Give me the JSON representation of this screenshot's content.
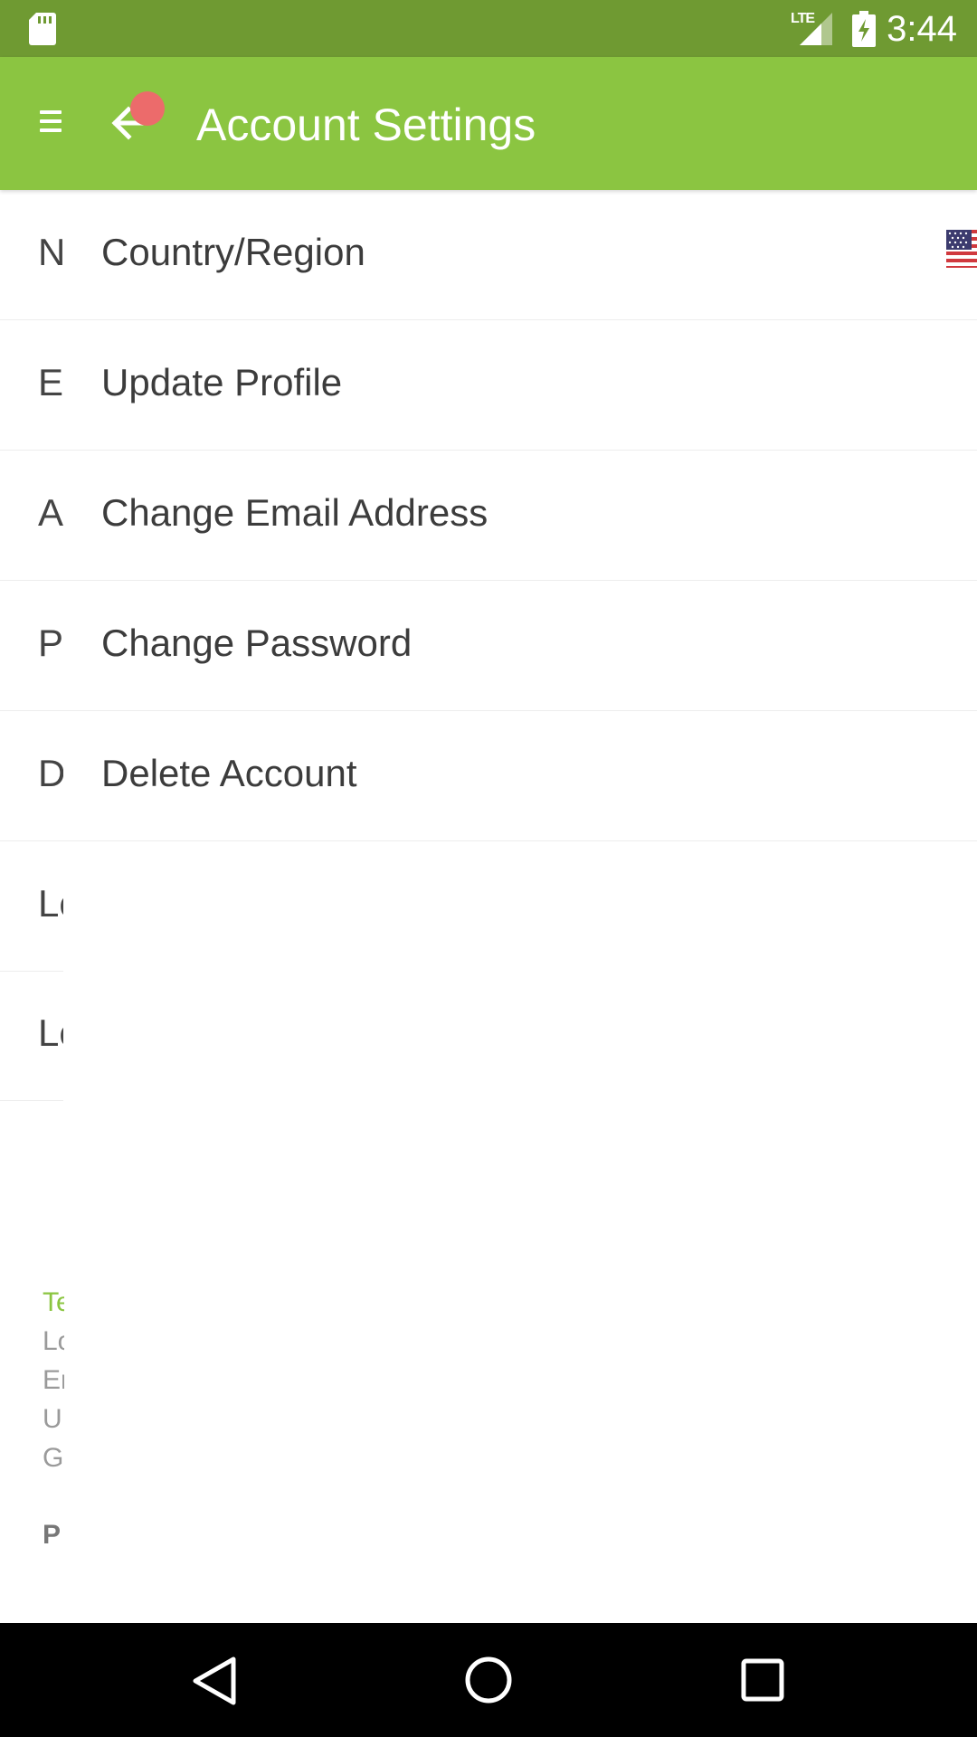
{
  "status_bar": {
    "network": "LTE",
    "time": "3:44"
  },
  "app_bar": {
    "title": "Account Settings",
    "menu_icon": "menu-icon",
    "back_icon": "arrow-back-icon"
  },
  "rows": [
    {
      "bg_text": "N",
      "label": "Country/Region",
      "trailing_icon": "us-flag-icon"
    },
    {
      "bg_text": "Er",
      "label": "Update Profile"
    },
    {
      "bg_text": "A",
      "label": "Change Email Address"
    },
    {
      "bg_text": "P",
      "label": "Change Password"
    },
    {
      "bg_text": "D",
      "label": "Delete Account"
    },
    {
      "bg_text": "Lo",
      "label": ""
    },
    {
      "bg_text": "Lo",
      "label": ""
    }
  ],
  "footer": {
    "title": "Te",
    "lines": [
      "Lo",
      "Er",
      "U.",
      "G"
    ],
    "bold": "P"
  },
  "colors": {
    "status_bar": "#6f9a32",
    "app_bar": "#8bc541",
    "notification_dot": "#ec6b6b"
  }
}
